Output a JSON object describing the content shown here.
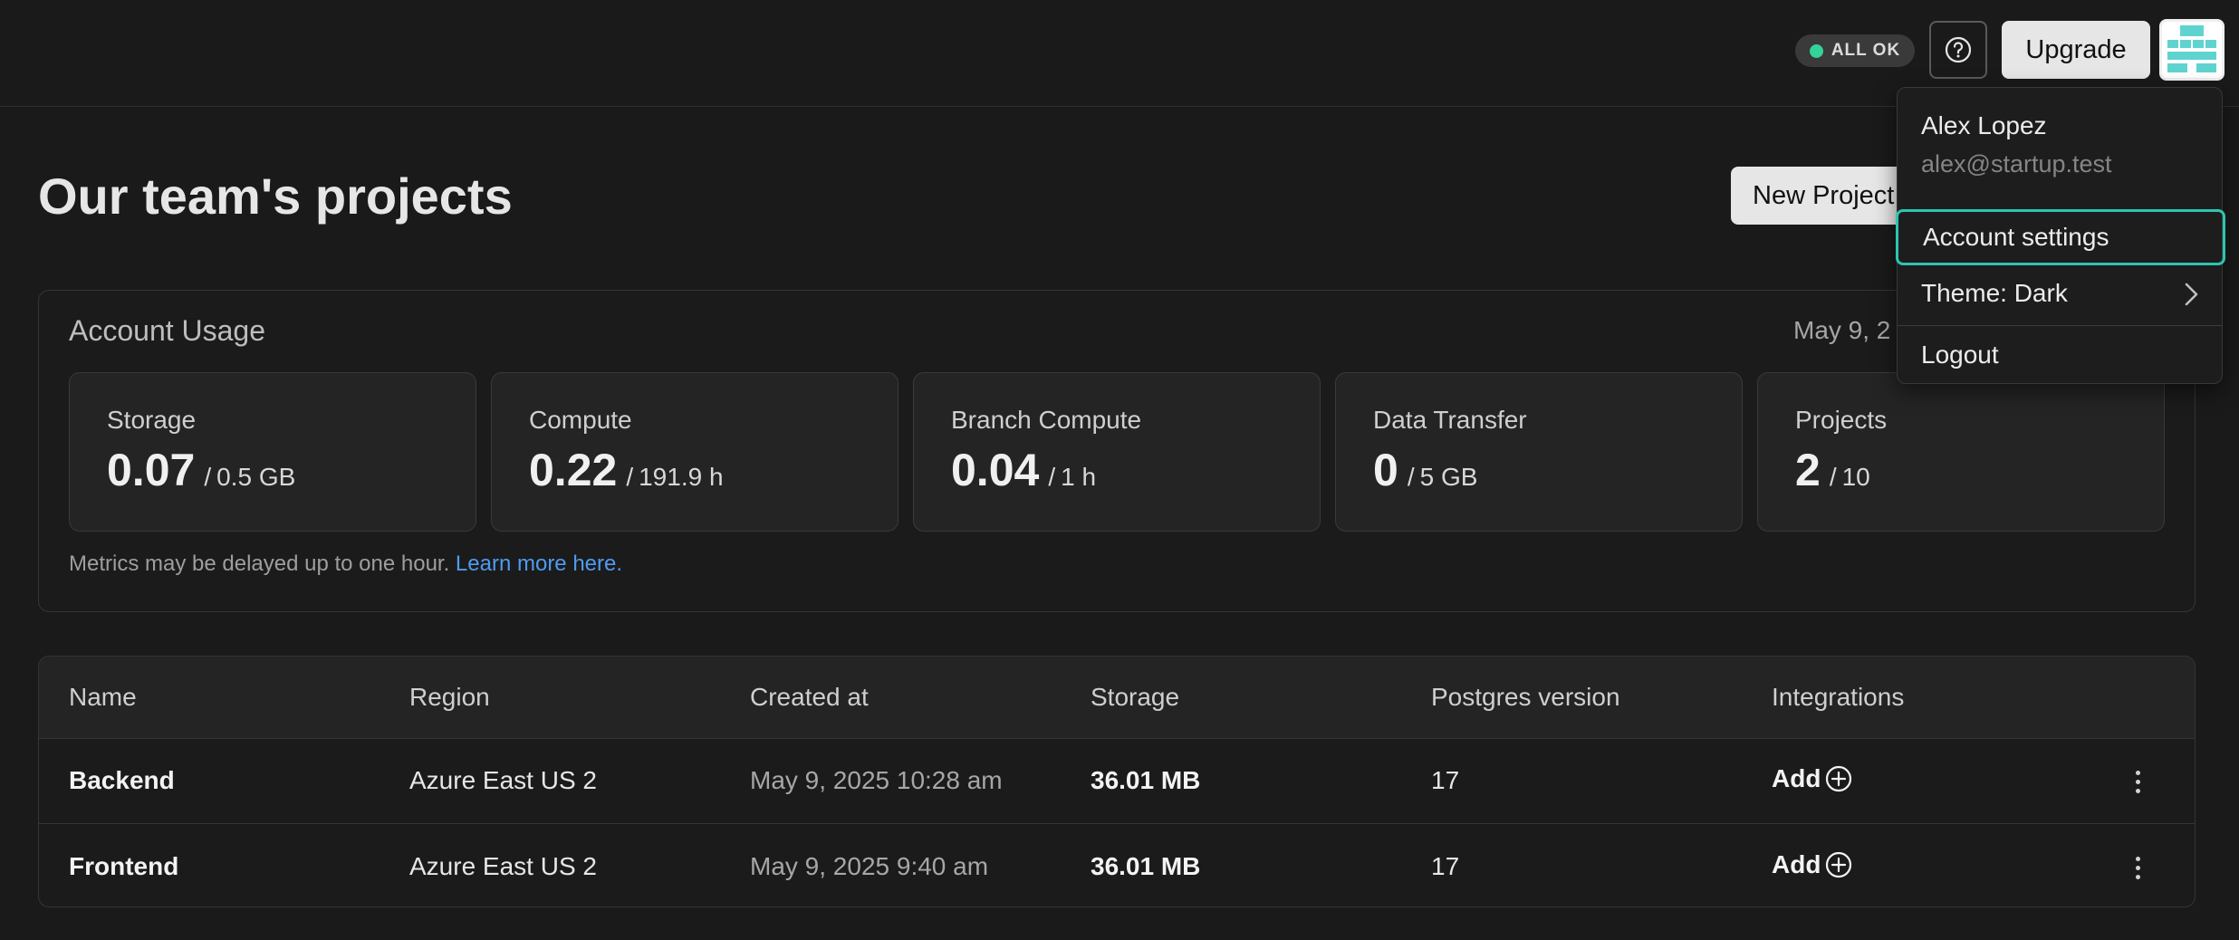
{
  "header": {
    "status": {
      "label": "ALL OK",
      "color": "#34d399"
    },
    "help_icon": "question-circle-icon",
    "upgrade_label": "Upgrade",
    "avatar_icon": "identicon-avatar"
  },
  "page": {
    "title": "Our team's projects",
    "new_project_label": "New Project"
  },
  "usage": {
    "title": "Account Usage",
    "date": "May 9, 2",
    "metrics": [
      {
        "label": "Storage",
        "value": "0.07",
        "limit": "0.5 GB"
      },
      {
        "label": "Compute",
        "value": "0.22",
        "limit": "191.9 h"
      },
      {
        "label": "Branch Compute",
        "value": "0.04",
        "limit": "1 h"
      },
      {
        "label": "Data Transfer",
        "value": "0",
        "limit": "5 GB"
      },
      {
        "label": "Projects",
        "value": "2",
        "limit": "10"
      }
    ],
    "separator": "/",
    "note": "Metrics may be delayed up to one hour.",
    "note_link": "Learn more here."
  },
  "table": {
    "columns": [
      "Name",
      "Region",
      "Created at",
      "Storage",
      "Postgres version",
      "Integrations"
    ],
    "rows": [
      {
        "name": "Backend",
        "region": "Azure East US 2",
        "created": "May 9, 2025 10:28 am",
        "storage": "36.01 MB",
        "pg": "17",
        "integrations": "Add"
      },
      {
        "name": "Frontend",
        "region": "Azure East US 2",
        "created": "May 9, 2025 9:40 am",
        "storage": "36.01 MB",
        "pg": "17",
        "integrations": "Add"
      }
    ],
    "row_menu_icon": "kebab-vertical-icon",
    "add_icon": "plus-circle-icon"
  },
  "user_menu": {
    "name": "Alex Lopez",
    "email": "alex@startup.test",
    "items": [
      {
        "label": "Account settings",
        "selected": true
      },
      {
        "label": "Theme: Dark",
        "has_submenu": true
      },
      {
        "label": "Logout"
      }
    ],
    "accent": "#2ec4b0"
  }
}
